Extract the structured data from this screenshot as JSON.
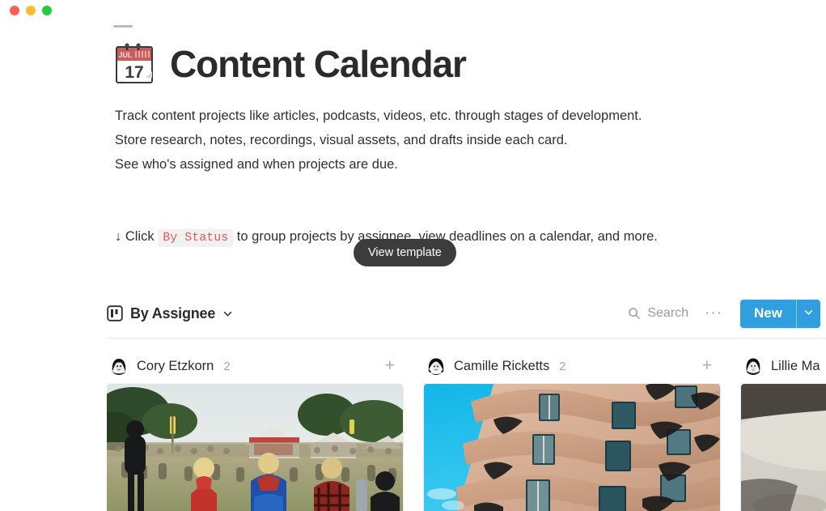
{
  "window": {
    "traffic_lights": [
      "close-red",
      "minimize-yellow",
      "maximize-green"
    ],
    "colors": {
      "red": "#ff5f57",
      "yellow": "#febc2e",
      "green": "#28c840"
    }
  },
  "page": {
    "emoji": "calendar-jul-17",
    "emoji_month": "JUL",
    "emoji_day": "17",
    "title": "Content Calendar",
    "body_lines": [
      "Track content projects like articles, podcasts, videos, etc. through stages of development.",
      "Store research, notes, recordings, visual assets, and drafts inside each card.",
      "See who's assigned and when projects are due."
    ],
    "callout": {
      "prefix": "↓ Click",
      "code": "By Status",
      "suffix": "to group projects by assignee, view deadlines on a calendar, and more."
    }
  },
  "tooltip": {
    "label": "View template"
  },
  "toolbar": {
    "view_icon": "board-icon",
    "view_label": "By Assignee",
    "view_chevron": "chevron-down-icon",
    "search_icon": "search-icon",
    "search_placeholder": "Search",
    "more_label": "···",
    "new_label": "New",
    "new_caret": "chevron-down-icon",
    "accent_color": "#2f9fe0"
  },
  "board": {
    "columns": [
      {
        "assignee": "Cory Etzkorn",
        "count": "2",
        "add_label": "+",
        "avatar": "avatar-cory-etzkorn",
        "card": {
          "image": "festival-crowd-photo"
        }
      },
      {
        "assignee": "Camille Ricketts",
        "count": "2",
        "add_label": "+",
        "avatar": "avatar-camille-ricketts",
        "card": {
          "image": "casa-mila-architecture-photo"
        }
      },
      {
        "assignee": "Lillie Ma",
        "count": "",
        "add_label": "+",
        "avatar": "avatar-lillie-ma",
        "card": {
          "image": "warm-brown-texture-photo"
        }
      }
    ]
  }
}
